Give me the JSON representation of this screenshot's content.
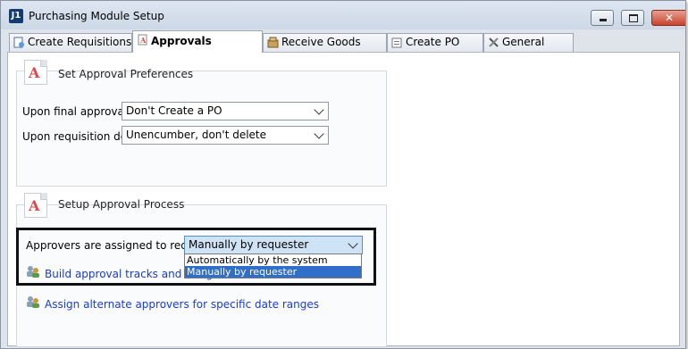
{
  "window": {
    "app_icon_text": "J1",
    "title": "Purchasing Module Setup",
    "close_glyph": "✕"
  },
  "tabs": [
    {
      "label": "Create Requisitions",
      "active": false
    },
    {
      "label": "Approvals",
      "active": true
    },
    {
      "label": "Receive Goods",
      "active": false
    },
    {
      "label": "Create PO",
      "active": false
    },
    {
      "label": "General",
      "active": false
    }
  ],
  "approval_preferences": {
    "title": "Set Approval Preferences",
    "final_approval_label": "Upon final approval:",
    "final_approval_value": "Don't Create a PO",
    "denial_label": "Upon requisition denial:",
    "denial_value": "Unencumber, don't delete"
  },
  "approval_process": {
    "title": "Setup Approval Process",
    "assign_label": "Approvers are assigned to requisition:",
    "assign_value": "Manually by requester",
    "dropdown_options": [
      {
        "label": "Automatically by the system",
        "selected": false
      },
      {
        "label": "Manually by requester",
        "selected": true
      }
    ],
    "link_tracks": "Build approval tracks and assign a",
    "link_alternate": "Assign alternate approvers for specific date ranges"
  },
  "colors": {
    "link": "#1a3bd1",
    "selection": "#2f6fc9",
    "highlight_border": "#111111"
  }
}
